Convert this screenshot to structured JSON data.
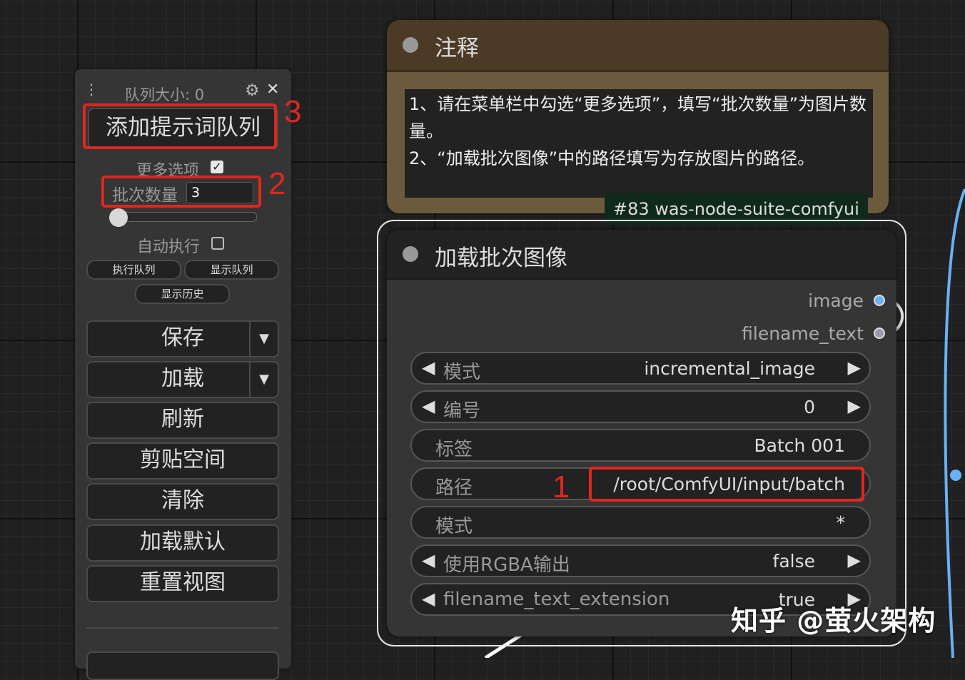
{
  "menu": {
    "queue_size": "队列大小: 0",
    "queue_prompt_label": "添加提示词队列",
    "more_options_label": "更多选项",
    "more_options_checked": true,
    "batch_count_label": "批次数量",
    "batch_count_value": "3",
    "auto_queue_label": "自动执行",
    "auto_queue_checked": false,
    "execute_queue_label": "执行队列",
    "view_queue_label": "显示队列",
    "view_history_label": "显示历史",
    "buttons": {
      "save": "保存",
      "load": "加载",
      "refresh": "刷新",
      "clipspace": "剪贴空间",
      "clear": "清除",
      "load_default": "加载默认",
      "reset_view": "重置视图"
    },
    "dropdown_glyph": "▼",
    "settings_icon": "⚙",
    "close_icon": "✕"
  },
  "annotations": {
    "num_1": "1",
    "num_2": "2",
    "num_3": "3",
    "color": "#e0261f"
  },
  "note_node": {
    "title": "注释",
    "text": "1、请在菜单栏中勾选“更多选项”，填写“批次数量”为图片数量。\n2、“加载批次图像”中的路径填写为存放图片的路径。",
    "badge": "#83 was-node-suite-comfyui"
  },
  "batch_node": {
    "title": "加载批次图像",
    "outputs": {
      "image": "image",
      "image_color": "#6ab0f3",
      "filename_text": "filename_text",
      "filename_text_color": "#9a9ab0"
    },
    "widgets": {
      "mode_label": "模式",
      "mode_value": "incremental_image",
      "index_label": "编号",
      "index_value": "0",
      "label_label": "标签",
      "label_value": "Batch 001",
      "path_label": "路径",
      "path_value": "/root/ComfyUI/input/batch",
      "pattern_label": "模式",
      "pattern_value": "*",
      "rgba_label": "使用RGBA输出",
      "rgba_value": "false",
      "ext_label": "filename_text_extension",
      "ext_value": "true"
    },
    "arrow_left": "◀",
    "arrow_right": "▶"
  },
  "watermark": "知乎 @萤火架构"
}
